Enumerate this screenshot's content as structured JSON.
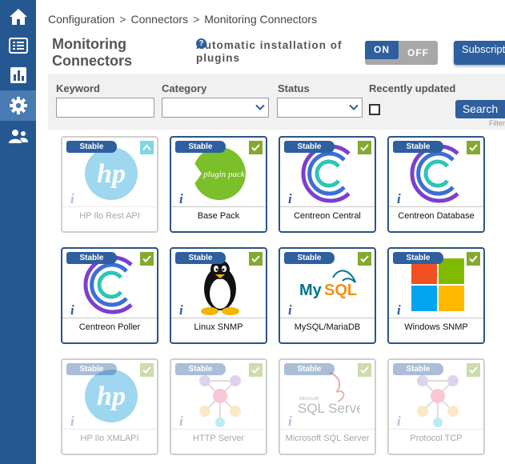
{
  "sidebar": {
    "items": [
      {
        "id": "home",
        "icon": "home-icon",
        "active": false
      },
      {
        "id": "monitoring",
        "icon": "list-icon",
        "active": false
      },
      {
        "id": "reporting",
        "icon": "bar-chart-icon",
        "active": false
      },
      {
        "id": "configuration",
        "icon": "gear-icon",
        "active": true
      },
      {
        "id": "administration",
        "icon": "users-icon",
        "active": false
      }
    ]
  },
  "breadcrumb": {
    "items": [
      "Configuration",
      "Connectors",
      "Monitoring Connectors"
    ],
    "separator": ">"
  },
  "header": {
    "title_line1": "Monitoring",
    "title_line2": "Connectors",
    "auto_install_label": "Automatic installation of plugins",
    "toggle_on": "ON",
    "toggle_off": "OFF",
    "subscription_label": "Subscription"
  },
  "filters": {
    "keyword_label": "Keyword",
    "keyword_value": "",
    "category_label": "Category",
    "category_value": "",
    "status_label": "Status",
    "status_value": "",
    "recent_label": "Recently updated",
    "recent_checked": false,
    "search_label": "Search",
    "filter_hint": "Filter"
  },
  "colors": {
    "primary": "#2e5f9e",
    "sidebar": "#255891",
    "check": "#84a930",
    "card_border": "#2c5586"
  },
  "cards": [
    {
      "name": "HP Ilo Rest API",
      "badge": "Stable",
      "logo": "hp-logo",
      "installed": false,
      "update": true
    },
    {
      "name": "Base Pack",
      "badge": "Stable",
      "logo": "plugin-pack-logo",
      "installed": true
    },
    {
      "name": "Centreon Central",
      "badge": "Stable",
      "logo": "centreon-logo",
      "installed": true
    },
    {
      "name": "Centreon Database",
      "badge": "Stable",
      "logo": "centreon-logo",
      "installed": true
    },
    {
      "name": "Centreon Poller",
      "badge": "Stable",
      "logo": "centreon-logo",
      "installed": true
    },
    {
      "name": "Linux SNMP",
      "badge": "Stable",
      "logo": "tux-logo",
      "installed": true
    },
    {
      "name": "MySQL/MariaDB",
      "badge": "Stable",
      "logo": "mysql-logo",
      "installed": true
    },
    {
      "name": "Windows SNMP",
      "badge": "Stable",
      "logo": "windows-logo",
      "installed": true
    },
    {
      "name": "HP Ilo XMLAPI",
      "badge": "Stable",
      "logo": "hp-logo",
      "installed": false
    },
    {
      "name": "HTTP Server",
      "badge": "Stable",
      "logo": "network-logo",
      "installed": false
    },
    {
      "name": "Microsoft SQL Server",
      "badge": "Stable",
      "logo": "sqlserver-logo",
      "installed": false
    },
    {
      "name": "Protocol TCP",
      "badge": "Stable",
      "logo": "network-logo",
      "installed": false
    }
  ]
}
